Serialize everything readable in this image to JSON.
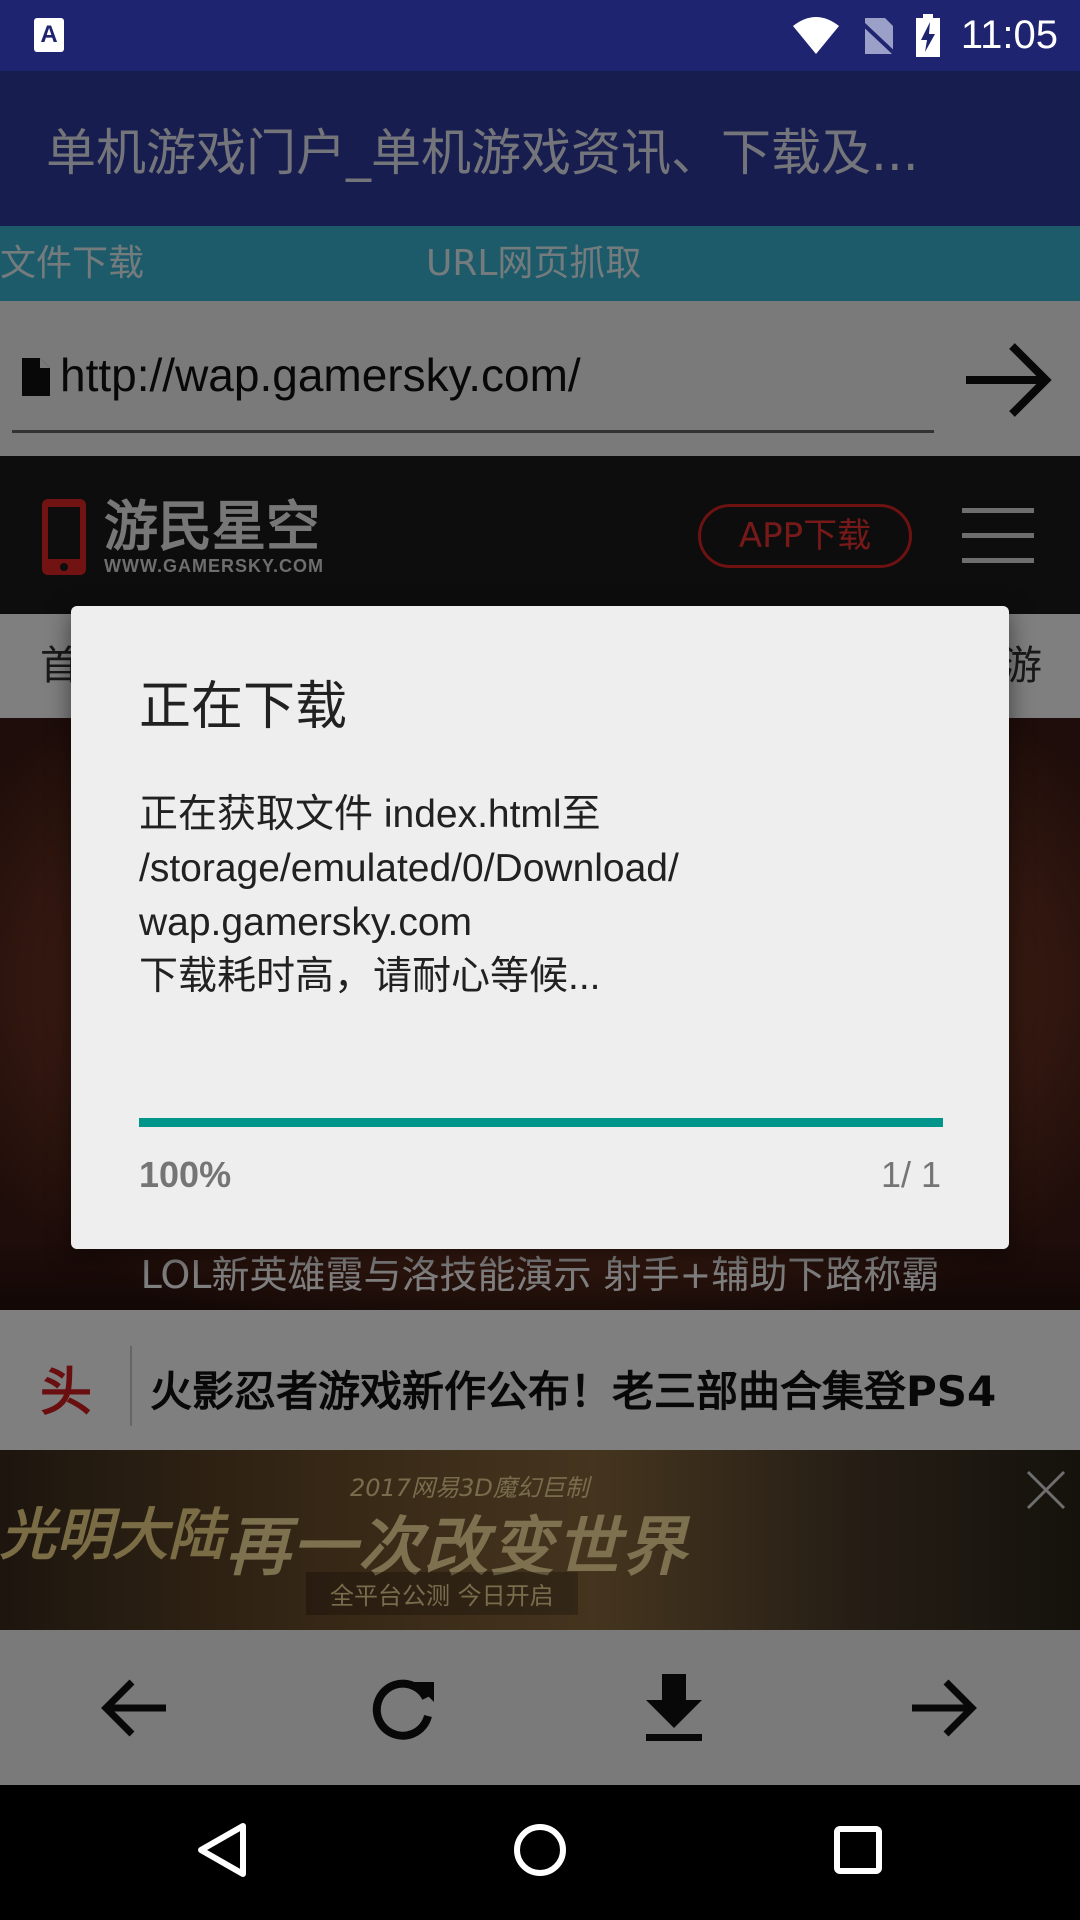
{
  "status_bar": {
    "time": "11:05",
    "left_icon_letter": "A"
  },
  "app_bar": {
    "title": "单机游戏门户_单机游戏资讯、下载及..."
  },
  "tabs": [
    {
      "label": "文件下载"
    },
    {
      "label": "URL网页抓取"
    }
  ],
  "url_bar": {
    "value": "http://wap.gamersky.com/"
  },
  "web": {
    "logo_name": "游民星空",
    "logo_url": "WWW.GAMERSKY.COM",
    "app_download_label": "APP下载",
    "nav_left_partial": "首",
    "nav_right_partial": "游",
    "banner_caption": "LOL新英雄霞与洛技能演示 射手+辅助下路称霸",
    "headline_tag": "头",
    "headline_text": "火影忍者游戏新作公布！老三部曲合集登PS4",
    "ad": {
      "top_text": "2017网易3D魔幻巨制",
      "title": "光明大陆",
      "slogan": "再一次改变世界",
      "bottom_text": "全平台公测  今日开启"
    }
  },
  "dialog": {
    "title": "正在下载",
    "message_lines": [
      "正在获取文件 index.html至",
      "/storage/emulated/0/Download/",
      "wap.gamersky.com",
      "下载耗时高，请耐心等候..."
    ],
    "progress_fraction": 1.0,
    "progress_percent_label": "100%",
    "progress_count_label": "1/ 1"
  },
  "colors": {
    "status_bar": "#1f2470",
    "app_bar": "#2f3a9c",
    "tab_bar": "#3ab6d6",
    "progress": "#00958a"
  },
  "icons": {
    "toolbar": [
      "back-arrow-icon",
      "refresh-icon",
      "download-icon",
      "forward-arrow-icon"
    ],
    "system": [
      "back-triangle-icon",
      "home-circle-icon",
      "recents-square-icon"
    ]
  }
}
